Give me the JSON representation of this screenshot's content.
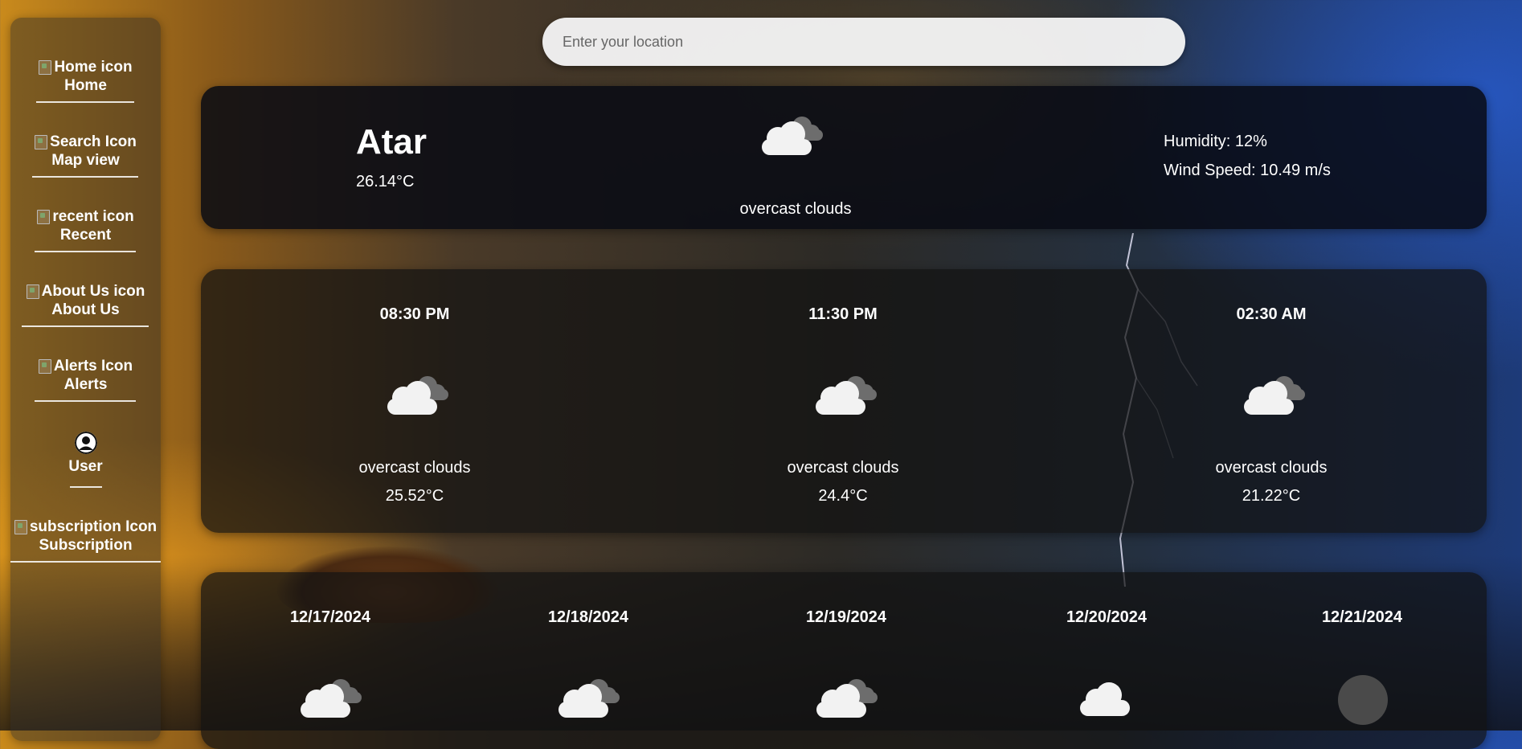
{
  "sidebar": {
    "items": [
      {
        "icon_alt": "Home icon",
        "label": "Home"
      },
      {
        "icon_alt": "Search Icon",
        "label": "Map view"
      },
      {
        "icon_alt": "recent icon",
        "label": "Recent"
      },
      {
        "icon_alt": "About Us icon",
        "label": "About Us"
      },
      {
        "icon_alt": "Alerts Icon",
        "label": "Alerts"
      },
      {
        "icon_alt": "",
        "label": "User"
      },
      {
        "icon_alt": "subscription Icon",
        "label": "Subscription"
      }
    ]
  },
  "search": {
    "placeholder": "Enter your location",
    "value": ""
  },
  "current": {
    "city": "Atar",
    "temperature": "26.14°C",
    "icon": "overcast-clouds-icon",
    "description": "overcast clouds",
    "humidity": "Humidity: 12%",
    "wind": "Wind Speed: 10.49 m/s"
  },
  "hourly": [
    {
      "time": "08:30 PM",
      "icon": "overcast-clouds-icon",
      "description": "overcast clouds",
      "temperature": "25.52°C"
    },
    {
      "time": "11:30 PM",
      "icon": "overcast-clouds-icon",
      "description": "overcast clouds",
      "temperature": "24.4°C"
    },
    {
      "time": "02:30 AM",
      "icon": "overcast-clouds-icon",
      "description": "overcast clouds",
      "temperature": "21.22°C"
    }
  ],
  "daily": [
    {
      "date": "12/17/2024",
      "icon": "overcast-clouds-icon"
    },
    {
      "date": "12/18/2024",
      "icon": "overcast-clouds-icon"
    },
    {
      "date": "12/19/2024",
      "icon": "overcast-clouds-icon"
    },
    {
      "date": "12/20/2024",
      "icon": "cloud-icon"
    },
    {
      "date": "12/21/2024",
      "icon": "clear-sky-icon"
    }
  ]
}
